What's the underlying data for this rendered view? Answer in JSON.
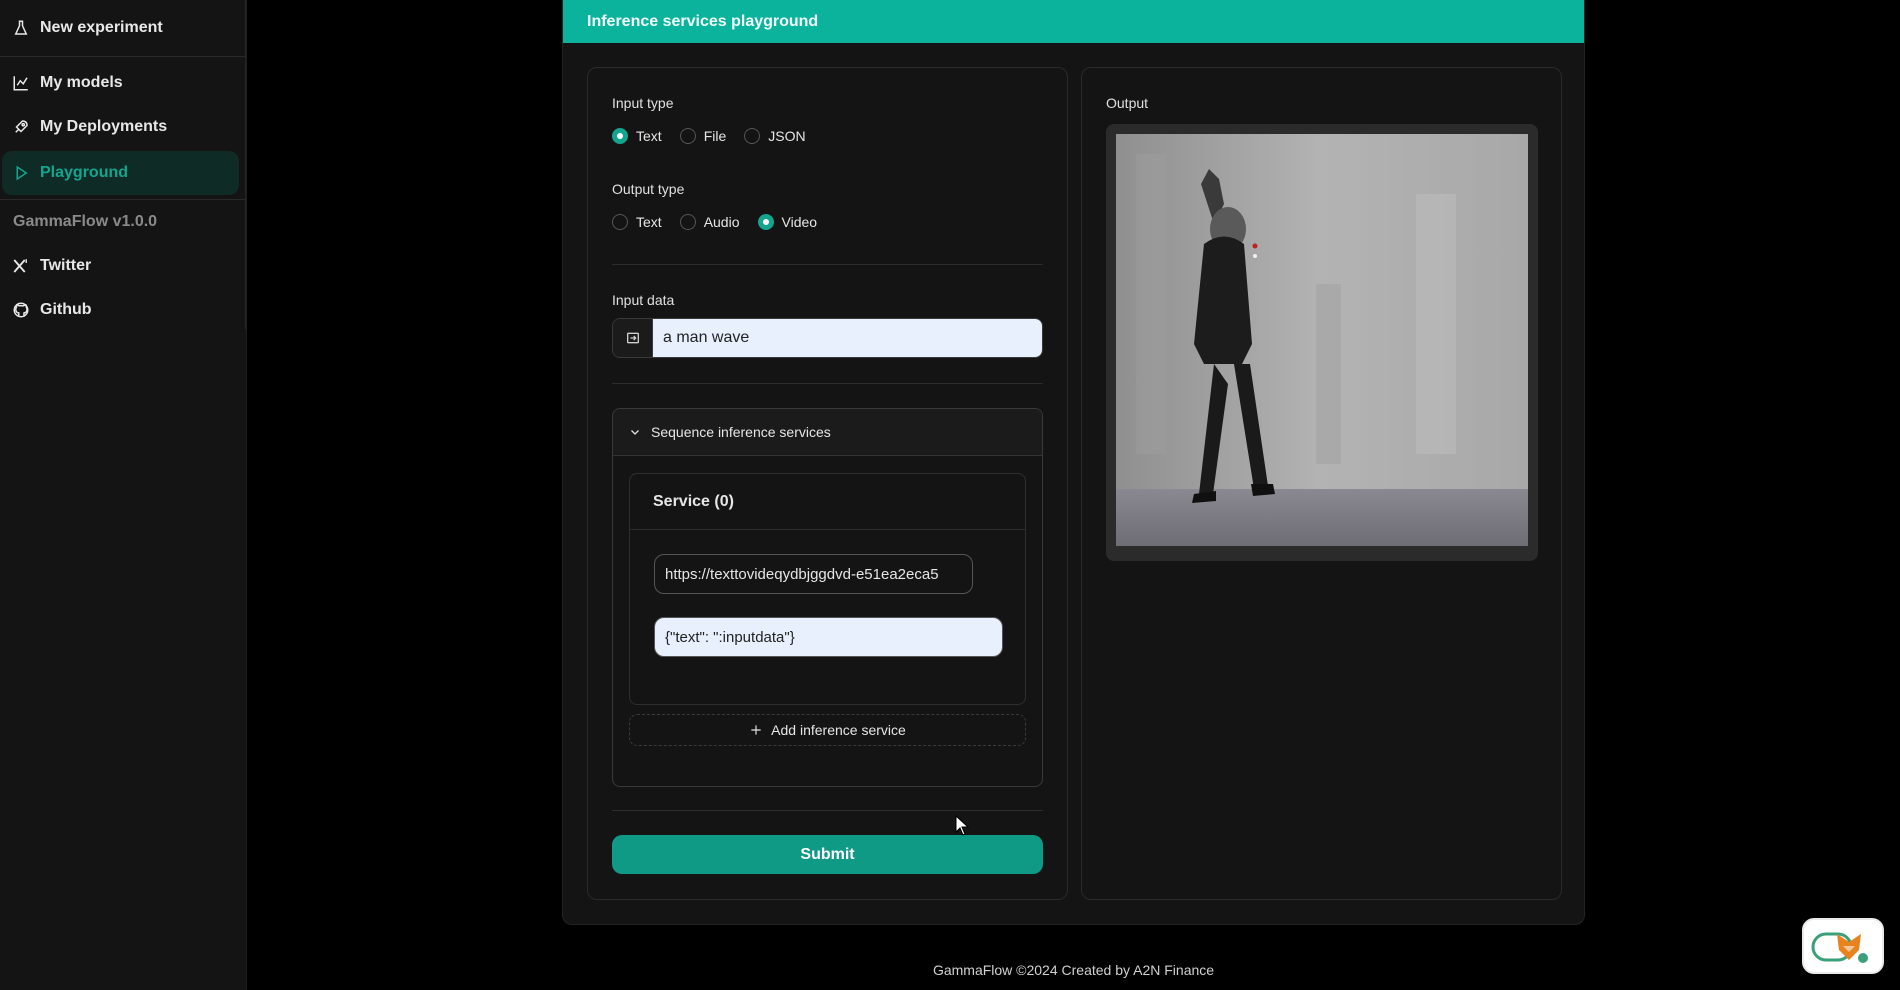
{
  "sidebar": {
    "items": [
      {
        "label": "New experiment",
        "icon": "flask-icon"
      },
      {
        "label": "My models",
        "icon": "chart-icon"
      },
      {
        "label": "My Deployments",
        "icon": "rocket-icon"
      },
      {
        "label": "Playground",
        "icon": "play-icon",
        "active": true
      }
    ],
    "version": "GammaFlow v1.0.0",
    "links": [
      {
        "label": "Twitter",
        "icon": "x-icon"
      },
      {
        "label": "Github",
        "icon": "github-icon"
      }
    ]
  },
  "header": {
    "title": "Inference services playground"
  },
  "form": {
    "input_type": {
      "label": "Input type",
      "options": [
        "Text",
        "File",
        "JSON"
      ],
      "selected": "Text"
    },
    "output_type": {
      "label": "Output type",
      "options": [
        "Text",
        "Audio",
        "Video"
      ],
      "selected": "Video"
    },
    "input_data": {
      "label": "Input data",
      "value": "a man wave"
    },
    "sequence": {
      "title": "Sequence inference services",
      "service_title": "Service (0)",
      "url_value": "https://texttovideqydbjggdvd-e51ea2eca5",
      "payload_value": "{\"text\": \":inputdata\"}",
      "add_label": "Add inference service"
    },
    "submit_label": "Submit"
  },
  "output": {
    "label": "Output"
  },
  "footer": {
    "text": "GammaFlow ©2024 Created by A2N Finance"
  },
  "colors": {
    "accent": "#0bb39c",
    "active_nav_bg": "#0f2b26",
    "submit": "#0f9a85"
  }
}
